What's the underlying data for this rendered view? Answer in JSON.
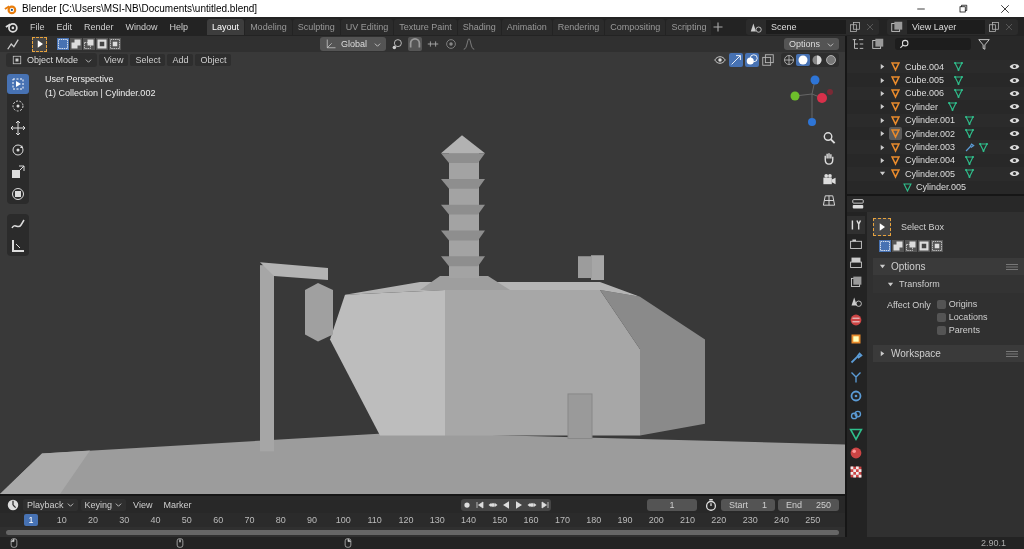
{
  "window": {
    "title": "Blender [C:\\Users\\MSI-NB\\Documents\\untitled.blend]"
  },
  "menu": [
    "File",
    "Edit",
    "Render",
    "Window",
    "Help"
  ],
  "workspaces": [
    {
      "label": "Layout",
      "selected": true
    },
    {
      "label": "Modeling",
      "selected": false
    },
    {
      "label": "Sculpting",
      "selected": false
    },
    {
      "label": "UV Editing",
      "selected": false
    },
    {
      "label": "Texture Paint",
      "selected": false
    },
    {
      "label": "Shading",
      "selected": false
    },
    {
      "label": "Animation",
      "selected": false
    },
    {
      "label": "Rendering",
      "selected": false
    },
    {
      "label": "Compositing",
      "selected": false
    },
    {
      "label": "Scripting",
      "selected": false
    }
  ],
  "scene": {
    "name": "Scene"
  },
  "view_layer": {
    "name": "View Layer"
  },
  "viewport": {
    "select_modes": [
      {
        "selected": true
      },
      {
        "selected": false
      },
      {
        "selected": false
      },
      {
        "selected": false
      },
      {
        "selected": false
      }
    ],
    "orientation": "Global",
    "options": "Options",
    "mode": "Object Mode",
    "menus": [
      "View",
      "Select",
      "Add",
      "Object"
    ],
    "shading": [
      {
        "kind": "wireframe",
        "selected": false
      },
      {
        "kind": "solid",
        "selected": true
      },
      {
        "kind": "material",
        "selected": false
      },
      {
        "kind": "rendered",
        "selected": false
      }
    ],
    "info": [
      "User Perspective",
      "(1) Collection | Cylinder.002"
    ],
    "tool_groups": [
      [
        {
          "kind": "select_box",
          "selected": true
        },
        {
          "kind": "cursor",
          "selected": false
        },
        {
          "kind": "move",
          "selected": false
        },
        {
          "kind": "rotate",
          "selected": false
        },
        {
          "kind": "scale",
          "selected": false
        },
        {
          "kind": "transform",
          "selected": false
        }
      ],
      [
        {
          "kind": "annotate",
          "selected": false
        },
        {
          "kind": "measure",
          "selected": false
        }
      ]
    ]
  },
  "outliner": {
    "items": [
      {
        "name": "Cube.004",
        "expanded": false,
        "selected": false,
        "modifier": false
      },
      {
        "name": "Cube.005",
        "expanded": false,
        "selected": false,
        "modifier": false
      },
      {
        "name": "Cube.006",
        "expanded": false,
        "selected": false,
        "modifier": false
      },
      {
        "name": "Cylinder",
        "expanded": false,
        "selected": false,
        "modifier": false
      },
      {
        "name": "Cylinder.001",
        "expanded": false,
        "selected": false,
        "modifier": false
      },
      {
        "name": "Cylinder.002",
        "expanded": false,
        "selected": true,
        "modifier": false
      },
      {
        "name": "Cylinder.003",
        "expanded": false,
        "selected": false,
        "modifier": true
      },
      {
        "name": "Cylinder.004",
        "expanded": false,
        "selected": false,
        "modifier": false
      },
      {
        "name": "Cylinder.005",
        "expanded": true,
        "selected": false,
        "modifier": false,
        "children": [
          {
            "name": "Cylinder.005"
          }
        ]
      }
    ]
  },
  "properties": {
    "tabs": [
      {
        "kind": "tool",
        "selected": true
      },
      {
        "kind": "render",
        "selected": false
      },
      {
        "kind": "output",
        "selected": false
      },
      {
        "kind": "view_layer",
        "selected": false
      },
      {
        "kind": "scene",
        "selected": false
      },
      {
        "kind": "world",
        "selected": false
      },
      {
        "kind": "object",
        "selected": false
      },
      {
        "kind": "modifier",
        "selected": false
      },
      {
        "kind": "particles",
        "selected": false
      },
      {
        "kind": "physics",
        "selected": false
      },
      {
        "kind": "constraints",
        "selected": false
      },
      {
        "kind": "data",
        "selected": false
      },
      {
        "kind": "material",
        "selected": false
      },
      {
        "kind": "texture",
        "selected": false
      }
    ],
    "tool_name": "Select Box",
    "select_modes": [
      {
        "selected": true
      },
      {
        "selected": false
      },
      {
        "selected": false
      },
      {
        "selected": false
      },
      {
        "selected": false
      }
    ],
    "panels": [
      {
        "title": "Options",
        "expanded": true,
        "subpanels": [
          {
            "title": "Transform",
            "expanded": true,
            "label": "Affect Only",
            "options": [
              {
                "label": "Origins",
                "checked": false
              },
              {
                "label": "Locations",
                "checked": false
              },
              {
                "label": "Parents",
                "checked": false
              }
            ]
          }
        ]
      },
      {
        "title": "Workspace",
        "expanded": false
      }
    ]
  },
  "timeline": {
    "menus": [
      {
        "label": "Playback",
        "dropdown": true
      },
      {
        "label": "Keying",
        "dropdown": true
      },
      {
        "label": "View",
        "dropdown": false
      },
      {
        "label": "Marker",
        "dropdown": false
      }
    ],
    "current_frame": "1",
    "start_label": "Start",
    "start": "1",
    "end_label": "End",
    "end": "250",
    "ticks": [
      {
        "label": "1",
        "selected": true
      },
      {
        "label": "10",
        "selected": false
      },
      {
        "label": "20",
        "selected": false
      },
      {
        "label": "30",
        "selected": false
      },
      {
        "label": "40",
        "selected": false
      },
      {
        "label": "50",
        "selected": false
      },
      {
        "label": "60",
        "selected": false
      },
      {
        "label": "70",
        "selected": false
      },
      {
        "label": "80",
        "selected": false
      },
      {
        "label": "90",
        "selected": false
      },
      {
        "label": "100",
        "selected": false
      },
      {
        "label": "110",
        "selected": false
      },
      {
        "label": "120",
        "selected": false
      },
      {
        "label": "130",
        "selected": false
      },
      {
        "label": "140",
        "selected": false
      },
      {
        "label": "150",
        "selected": false
      },
      {
        "label": "160",
        "selected": false
      },
      {
        "label": "170",
        "selected": false
      },
      {
        "label": "180",
        "selected": false
      },
      {
        "label": "190",
        "selected": false
      },
      {
        "label": "200",
        "selected": false
      },
      {
        "label": "210",
        "selected": false
      },
      {
        "label": "220",
        "selected": false
      },
      {
        "label": "230",
        "selected": false
      },
      {
        "label": "240",
        "selected": false
      },
      {
        "label": "250",
        "selected": false
      }
    ]
  },
  "status_bar": {
    "version": "2.90.1"
  }
}
